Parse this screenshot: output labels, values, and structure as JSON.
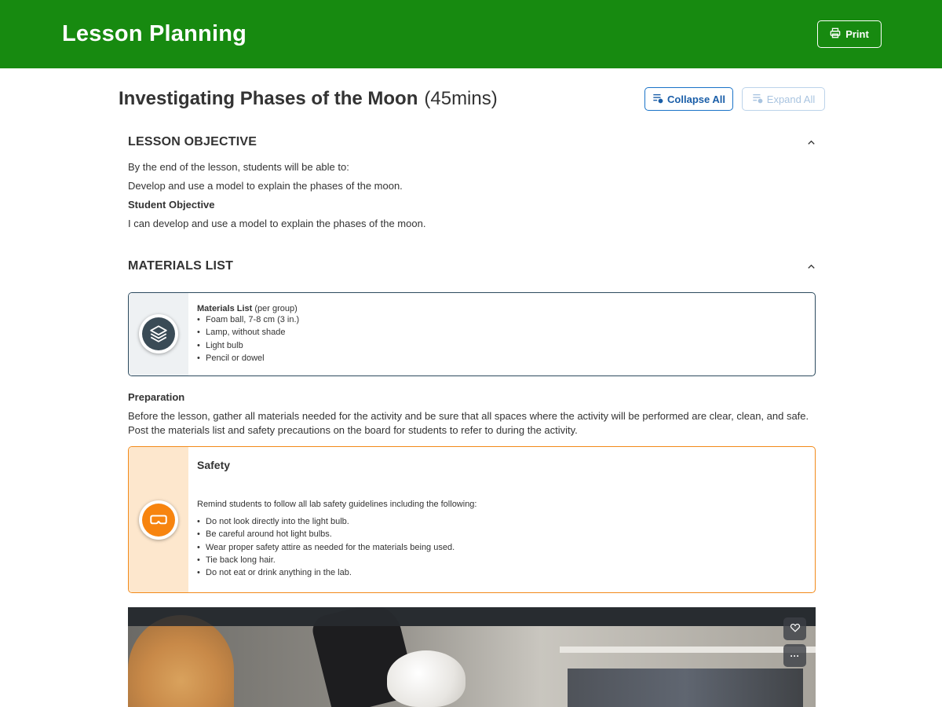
{
  "header": {
    "title": "Lesson Planning",
    "print_label": "Print",
    "color": "#178a10"
  },
  "lesson": {
    "title": "Investigating Phases of the Moon",
    "duration": "(45mins)"
  },
  "controls": {
    "collapse_label": "Collapse All",
    "expand_label": "Expand All"
  },
  "objective": {
    "heading": "LESSON OBJECTIVE",
    "intro": "By the end of the lesson, students will be able to:",
    "text": "Develop and use a model to explain the phases of the moon.",
    "student_heading": "Student Objective",
    "student_text": "I can develop and use a model to explain the phases of the moon."
  },
  "materials": {
    "heading": "MATERIALS LIST",
    "card": {
      "title": "Materials List",
      "title_suffix": "(per group)",
      "items": [
        "Foam ball, 7-8 cm (3 in.)",
        "Lamp, without shade",
        "Light bulb",
        "Pencil or dowel"
      ],
      "icon": "layers-icon",
      "accent": "#2c4a5e"
    },
    "preparation_heading": "Preparation",
    "preparation_lines": [
      "Before the lesson, gather all materials needed for the activity and be sure that all spaces where the activity will be performed are clear, clean, and safe.",
      "Post the materials list and safety precautions on the board for students to refer to during the activity."
    ]
  },
  "safety": {
    "title": "Safety",
    "intro": "Remind students to follow all lab safety guidelines including the following:",
    "items": [
      "Do not look directly into the light bulb.",
      "Be careful around hot light bulbs.",
      "Wear proper safety attire as needed for the materials being used.",
      "Tie back long hair.",
      "Do not eat or drink anything in the lab."
    ],
    "icon": "safety-goggles-icon",
    "accent": "#f28a1a"
  },
  "video": {
    "favorite_icon": "heart-icon",
    "more_label": "···"
  }
}
